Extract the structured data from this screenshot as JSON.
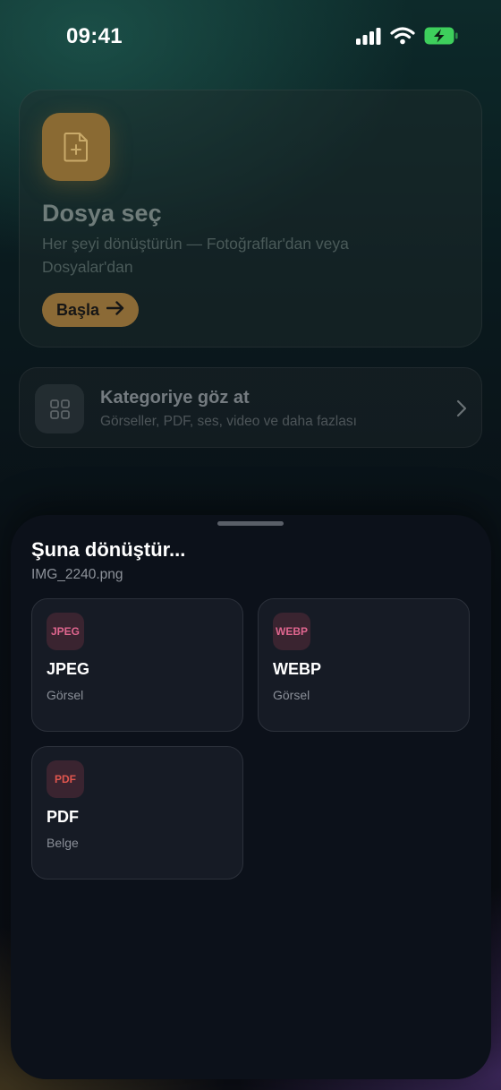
{
  "status_bar": {
    "time": "09:41"
  },
  "upload_card": {
    "title": "Dosya seç",
    "subtitle": "Her şeyi dönüştürün — Fotoğraflar'dan veya Dosyalar'dan",
    "start_label": "Başla",
    "icon": "file-plus-icon",
    "accent": "#8a6a33"
  },
  "category_row": {
    "title": "Kategoriye göz at",
    "subtitle": "Görseller, PDF, ses, video ve daha fazlası",
    "icon": "grid-icon"
  },
  "sheet": {
    "title": "Şuna dönüştür...",
    "filename": "IMG_2240.png",
    "formats": [
      {
        "badge": "JPEG",
        "name": "JPEG",
        "kind": "Görsel",
        "badge_color": "#e0668f"
      },
      {
        "badge": "WEBP",
        "name": "WEBP",
        "kind": "Görsel",
        "badge_color": "#e0668f"
      },
      {
        "badge": "PDF",
        "name": "PDF",
        "kind": "Belge",
        "badge_color": "#e0564e"
      }
    ]
  }
}
